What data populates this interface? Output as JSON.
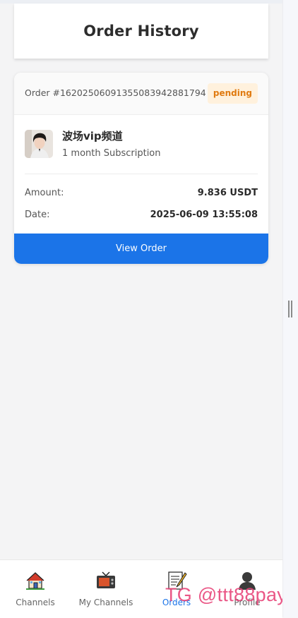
{
  "page": {
    "title": "Order History"
  },
  "order": {
    "id_label": "Order #162025060913550839428817​94",
    "status": "pending",
    "channel_name": "波场vip频道",
    "subscription": "1 month Subscription",
    "amount_label": "Amount:",
    "amount_value": "9.836 USDT",
    "date_label": "Date:",
    "date_value": "2025-06-09 13:55:08",
    "view_button": "View Order"
  },
  "nav": {
    "items": [
      {
        "label": "Channels",
        "icon": "house-icon",
        "active": false
      },
      {
        "label": "My Channels",
        "icon": "tv-icon",
        "active": false
      },
      {
        "label": "Orders",
        "icon": "memo-icon",
        "active": true
      },
      {
        "label": "Profile",
        "icon": "person-icon",
        "active": false
      }
    ]
  },
  "watermark": "TG @ttt88pay",
  "colors": {
    "primary": "#1b74e8",
    "pending_bg": "#fff1dd",
    "pending_text": "#e07a10",
    "watermark": "#e8457a"
  }
}
